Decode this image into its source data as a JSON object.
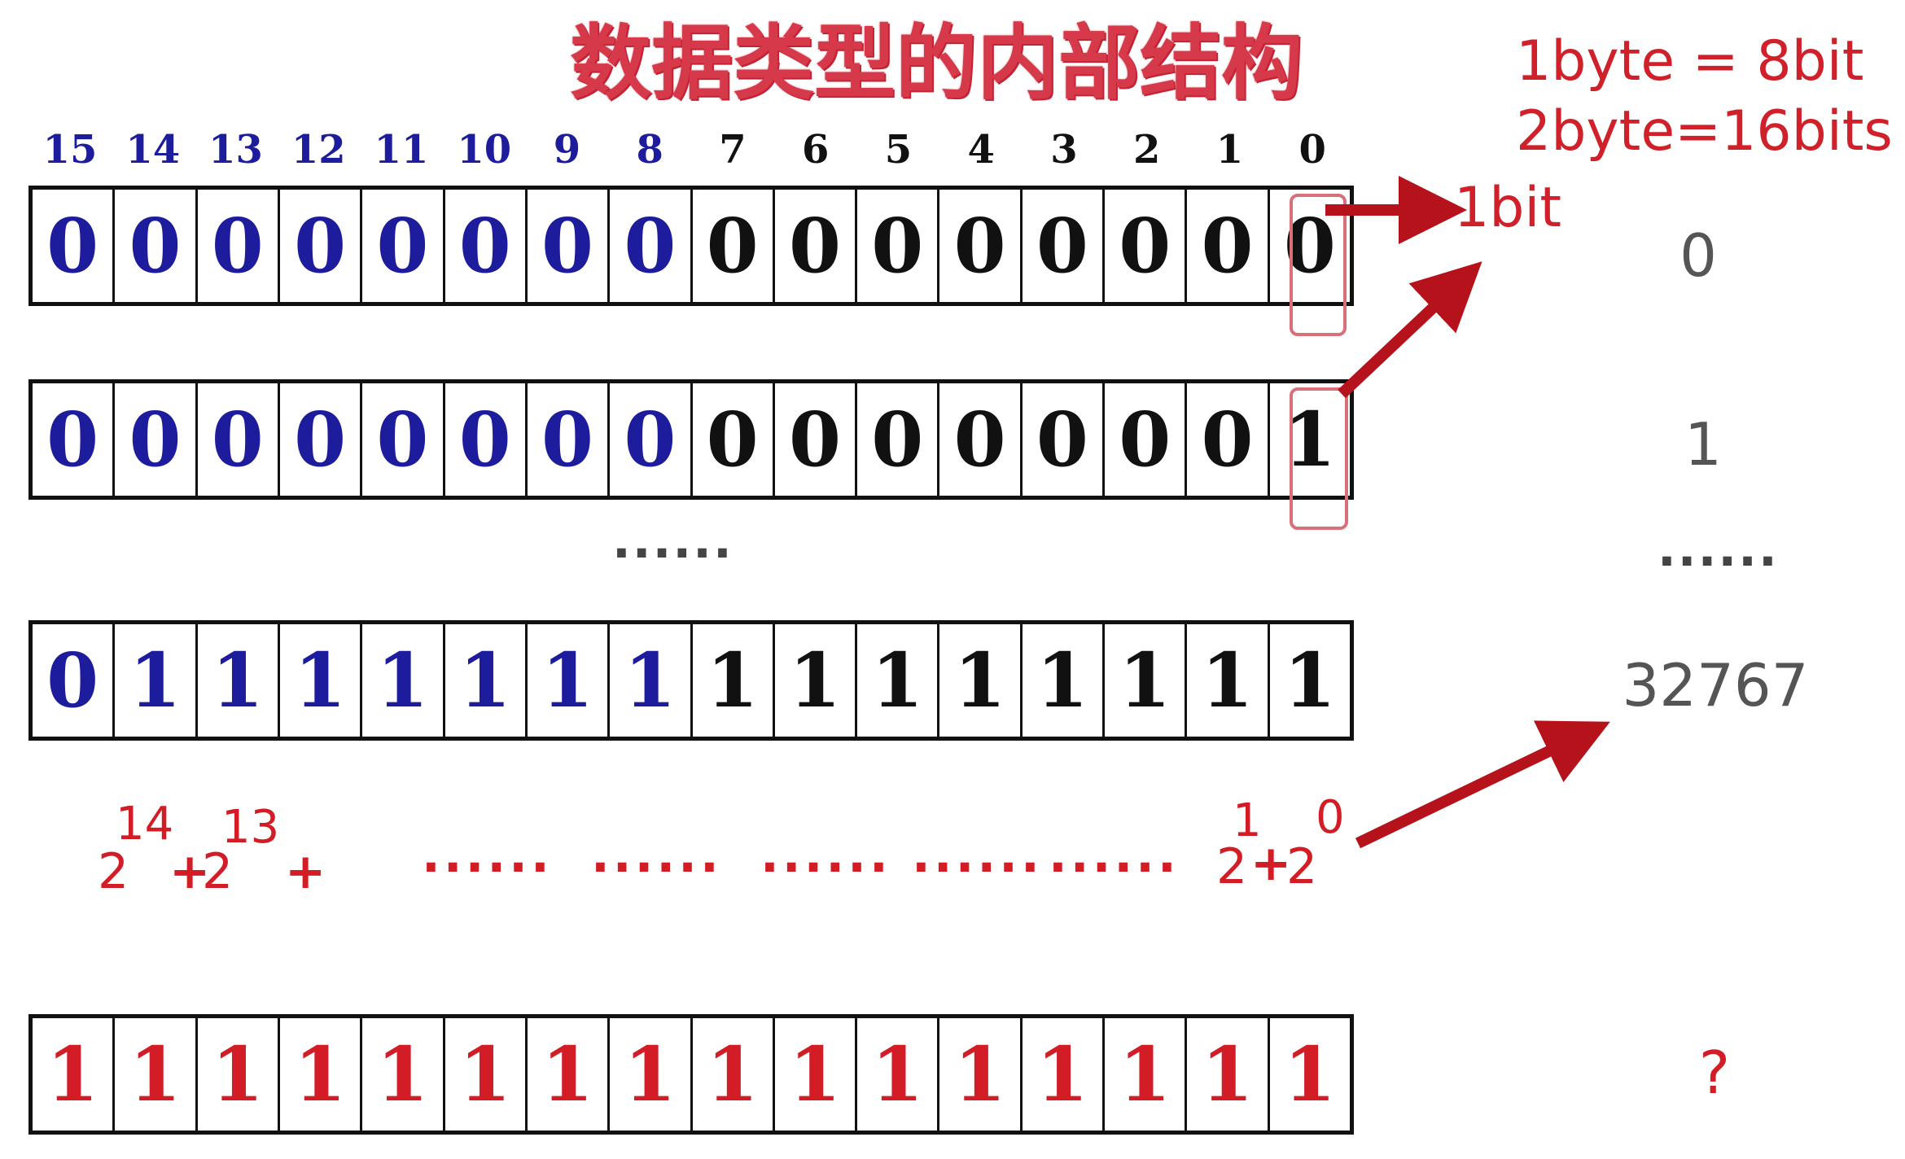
{
  "title": "数据类型的内部结构",
  "notes": [
    "1byte = 8bit",
    "2byte=16bits"
  ],
  "bit_label": "1bit",
  "bit_indices": [
    "15",
    "14",
    "13",
    "12",
    "11",
    "10",
    "9",
    "8",
    "7",
    "6",
    "5",
    "4",
    "3",
    "2",
    "1",
    "0"
  ],
  "rows": [
    {
      "bits": [
        "0",
        "0",
        "0",
        "0",
        "0",
        "0",
        "0",
        "0",
        "0",
        "0",
        "0",
        "0",
        "0",
        "0",
        "0",
        "0"
      ],
      "value": "0"
    },
    {
      "bits": [
        "0",
        "0",
        "0",
        "0",
        "0",
        "0",
        "0",
        "0",
        "0",
        "0",
        "0",
        "0",
        "0",
        "0",
        "0",
        "1"
      ],
      "value": "1"
    },
    {
      "bits": [
        "0",
        "1",
        "1",
        "1",
        "1",
        "1",
        "1",
        "1",
        "1",
        "1",
        "1",
        "1",
        "1",
        "1",
        "1",
        "1"
      ],
      "value": "32767"
    },
    {
      "bits": [
        "1",
        "1",
        "1",
        "1",
        "1",
        "1",
        "1",
        "1",
        "1",
        "1",
        "1",
        "1",
        "1",
        "1",
        "1",
        "1"
      ],
      "value": "?"
    }
  ],
  "ellipsis_mid": "......",
  "ellipsis_right": "......",
  "formula": {
    "base": "2",
    "exp14": "14",
    "exp13": "13",
    "plus": "+",
    "dots": [
      "......",
      "......",
      "......",
      "......",
      "......"
    ],
    "exp1": "1",
    "exp0": "0"
  },
  "colors": {
    "high_byte": "#1c1c9c",
    "low_byte": "#111111",
    "accent": "#d21d26",
    "arrow": "#b5121b"
  }
}
